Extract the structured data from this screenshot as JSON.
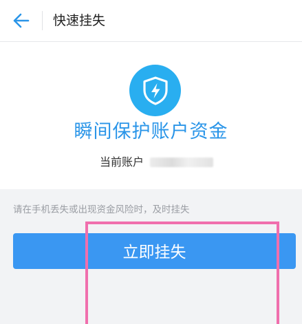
{
  "header": {
    "back_icon": "arrow-left-icon",
    "title": "快速挂失"
  },
  "card": {
    "badge_icon": "shield-lightning-icon",
    "headline": "瞬间保护账户资金",
    "account_label": "当前账户",
    "account_value_obscured": "blurred"
  },
  "hint": "请在手机丢失或出现资金风险时，及时挂失",
  "actions": {
    "report_loss_label": "立即挂失"
  },
  "colors": {
    "accent": "#2a95e8",
    "badge": "#29aef0",
    "button": "#3a97f2",
    "annotation": "#f06fad",
    "background": "#f2f3f5"
  }
}
